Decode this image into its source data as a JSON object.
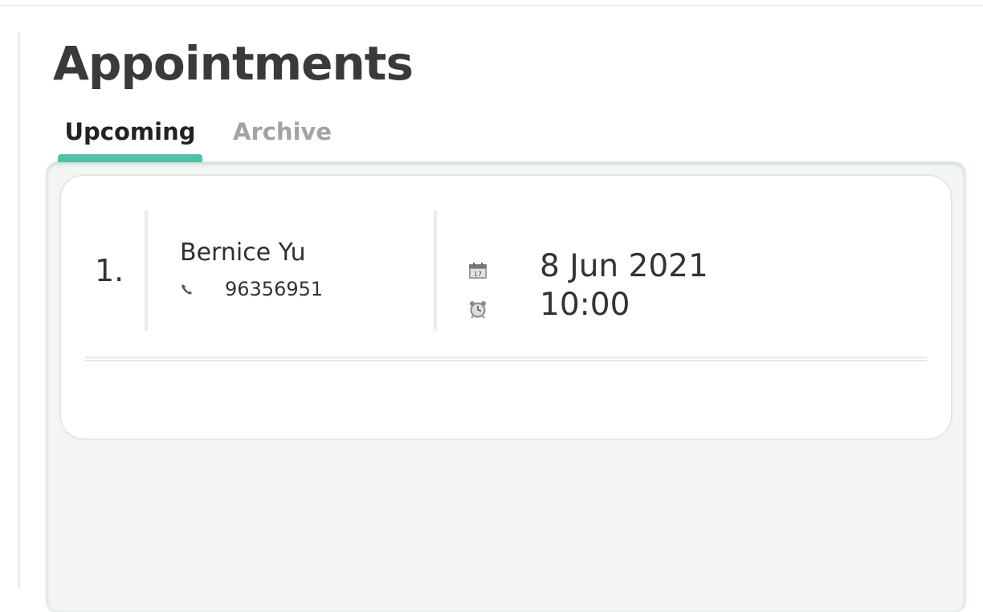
{
  "page": {
    "title": "Appointments"
  },
  "tabs": [
    {
      "label": "Upcoming",
      "active": true
    },
    {
      "label": "Archive",
      "active": false
    }
  ],
  "appointments": [
    {
      "index": "1.",
      "name": "Bernice Yu",
      "phone": "96356951",
      "date": "8 Jun 2021",
      "time": "10:00",
      "icons": {
        "phone": "phone-icon",
        "date": "calendar-icon",
        "time": "alarm-clock-icon"
      }
    }
  ],
  "colors": {
    "accent": "#4cc3a8",
    "title": "#3a3a3a",
    "active_tab": "#222222",
    "inactive_tab": "#a3a3a3",
    "panel_bg": "#f3f6f5"
  }
}
